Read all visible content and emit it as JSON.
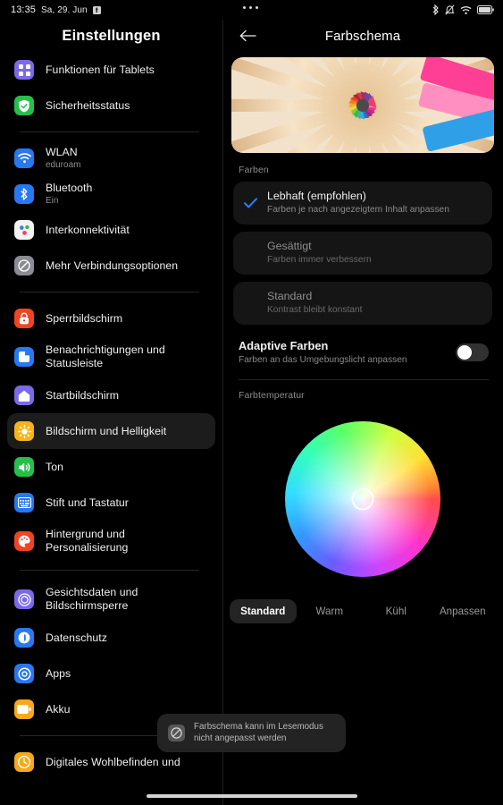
{
  "statusbar": {
    "time": "13:35",
    "date": "Sa, 29. Jun",
    "app_icon": "download-icon",
    "overflow_menu": "more-options",
    "icons": [
      "bluetooth-icon",
      "mute-bell-icon",
      "wifi-icon",
      "battery-icon"
    ]
  },
  "sidebar": {
    "title": "Einstellungen",
    "selected": "Bildschirm und Helligkeit",
    "groups": [
      {
        "items": [
          {
            "label": "Funktionen für Tablets",
            "sub": "",
            "icon": "grid-apps-icon",
            "color": "#7b69e8"
          },
          {
            "label": "Sicherheitsstatus",
            "sub": "",
            "icon": "shield-check-icon",
            "color": "#25bf4a"
          }
        ]
      },
      {
        "items": [
          {
            "label": "WLAN",
            "sub": "eduroam",
            "icon": "wifi-icon",
            "color": "#2878f0"
          },
          {
            "label": "Bluetooth",
            "sub": "Ein",
            "icon": "bluetooth-icon",
            "color": "#2878f0"
          },
          {
            "label": "Interkonnektivität",
            "sub": "",
            "icon": "dots-cluster-icon",
            "color": "#f2f2f2"
          },
          {
            "label": "Mehr Verbindungsoptionen",
            "sub": "",
            "icon": "link-slash-icon",
            "color": "#8b8b95"
          }
        ]
      },
      {
        "items": [
          {
            "label": "Sperrbildschirm",
            "sub": "",
            "icon": "lock-icon",
            "color": "#f04522"
          },
          {
            "label": "Benachrichtigungen und\nStatusleiste",
            "sub": "",
            "icon": "notification-icon",
            "color": "#2878f0"
          },
          {
            "label": "Startbildschirm",
            "sub": "",
            "icon": "home-icon",
            "color": "#7b69e8"
          },
          {
            "label": "Bildschirm und Helligkeit",
            "sub": "",
            "icon": "brightness-sun-icon",
            "color": "#f5b41b"
          },
          {
            "label": "Ton",
            "sub": "",
            "icon": "speaker-icon",
            "color": "#25bf4a"
          },
          {
            "label": "Stift und Tastatur",
            "sub": "",
            "icon": "keyboard-icon",
            "color": "#2878f0"
          },
          {
            "label": "Hintergrund und\nPersonalisierung",
            "sub": "",
            "icon": "palette-icon",
            "color": "#f04522"
          }
        ]
      },
      {
        "items": [
          {
            "label": "Gesichtsdaten und\nBildschirmsperre",
            "sub": "",
            "icon": "face-unlock-icon",
            "color": "#7b69e8"
          },
          {
            "label": "Datenschutz",
            "sub": "",
            "icon": "privacy-hand-icon",
            "color": "#2878f0"
          },
          {
            "label": "Apps",
            "sub": "",
            "icon": "apps-gear-icon",
            "color": "#2878f0"
          },
          {
            "label": "Akku",
            "sub": "",
            "icon": "battery-icon",
            "color": "#f5a91b"
          }
        ]
      },
      {
        "items": [
          {
            "label": "Digitales Wohlbefinden und",
            "sub": "",
            "icon": "wellbeing-icon",
            "color": "#f5a91b"
          }
        ]
      }
    ]
  },
  "detail": {
    "title": "Farbschema",
    "back_icon": "arrow-left-icon",
    "hero_image": "colored-pencils-radial-photo",
    "colors_label": "Farben",
    "options": [
      {
        "title": "Lebhaft (empfohlen)",
        "sub": "Farben je nach angezeigtem Inhalt anpassen",
        "selected": true
      },
      {
        "title": "Gesättigt",
        "sub": "Farben immer verbessern",
        "selected": false
      },
      {
        "title": "Standard",
        "sub": "Kontrast bleibt konstant",
        "selected": false
      }
    ],
    "adaptive": {
      "title": "Adaptive Farben",
      "sub": "Farben an das Umgebungslicht anpassen",
      "toggle_on": false
    },
    "temperature_label": "Farbtemperatur",
    "temperature_buttons": [
      "Standard",
      "Warm",
      "Kühl",
      "Anpassen"
    ],
    "temperature_selected": "Standard",
    "color_wheel": "color-picker-wheel"
  },
  "toast": {
    "icon": "restriction-icon",
    "message": "Farbschema kann im Lesemodus\nnicht angepasst werden"
  }
}
